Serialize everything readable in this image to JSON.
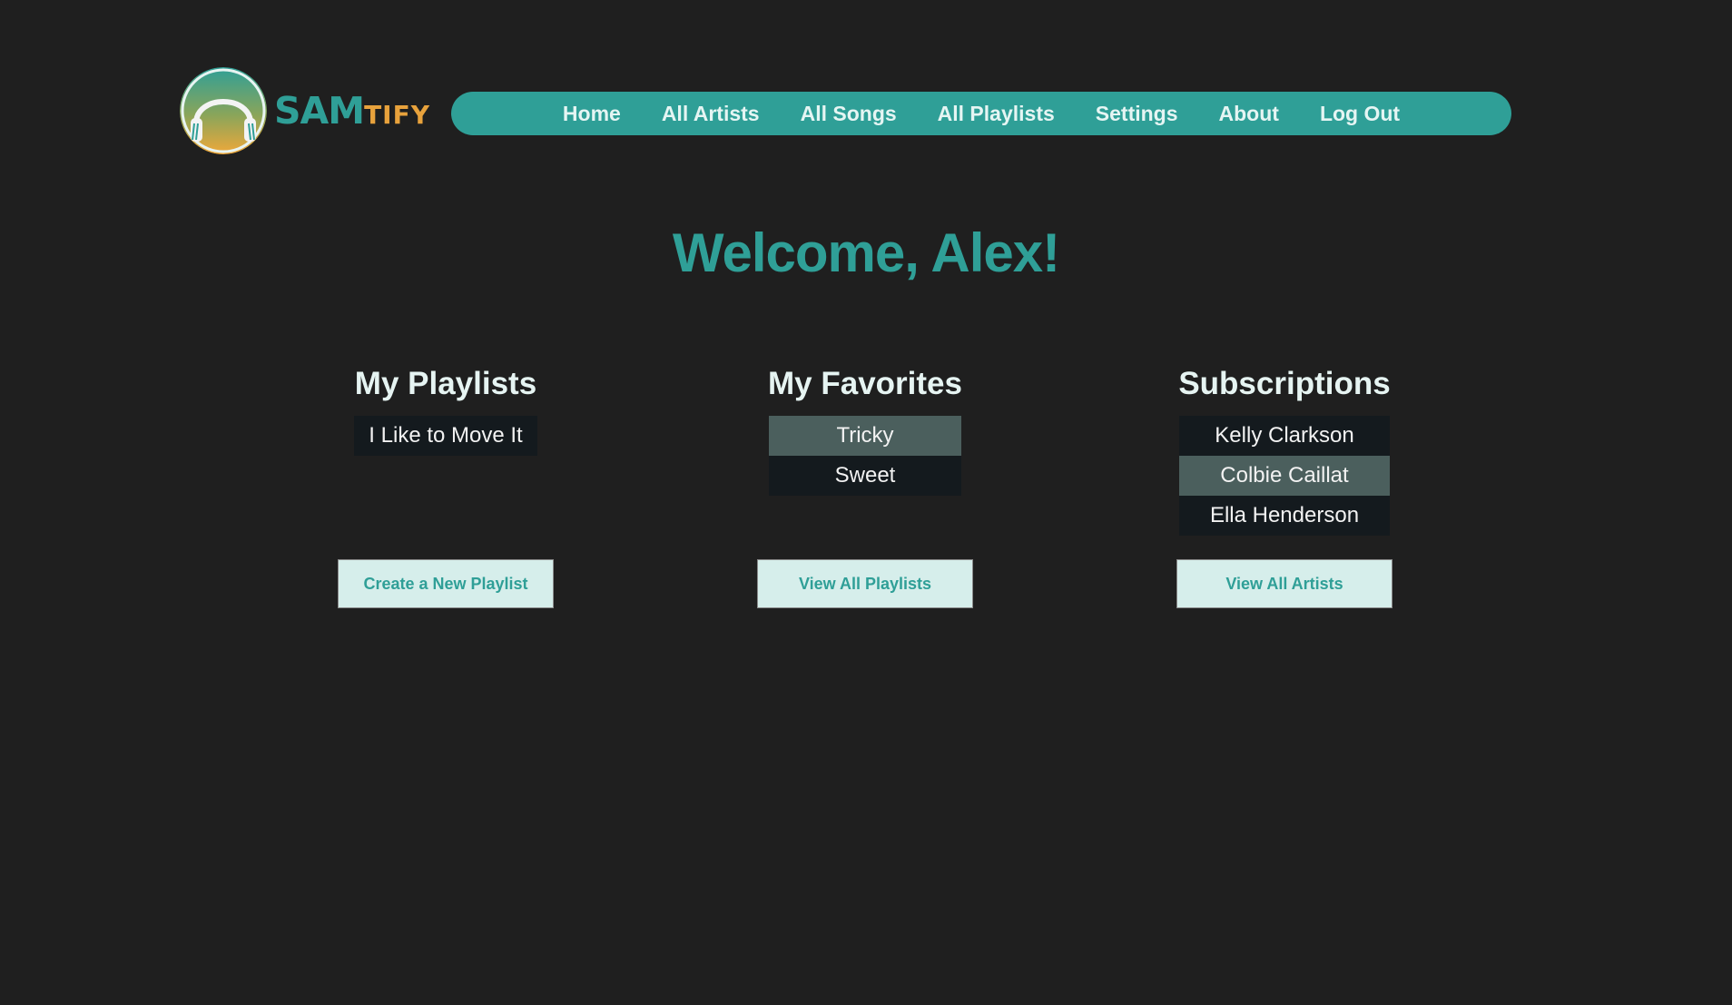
{
  "logo": {
    "sam": "SAM",
    "tify": "TIFY",
    "icon": "headphones-icon"
  },
  "nav": {
    "items": [
      "Home",
      "All Artists",
      "All Songs",
      "All Playlists",
      "Settings",
      "About",
      "Log Out"
    ]
  },
  "welcome": "Welcome, Alex!",
  "columns": {
    "playlists": {
      "title": "My Playlists",
      "items": [
        "I Like to Move It"
      ],
      "button": "Create a New Playlist"
    },
    "favorites": {
      "title": "My Favorites",
      "items": [
        "Tricky",
        "Sweet"
      ],
      "button": "View All Playlists"
    },
    "subscriptions": {
      "title": "Subscriptions",
      "items": [
        "Kelly Clarkson",
        "Colbie Caillat",
        "Ella Henderson"
      ],
      "button": "View All Artists"
    }
  },
  "colors": {
    "background": "#1f1f1f",
    "accent": "#2f9f97",
    "logo_orange": "#e8a23c",
    "list_item": "#141a1e",
    "list_item_highlight": "#4b5f5d",
    "button_bg": "#d6eeeb"
  }
}
